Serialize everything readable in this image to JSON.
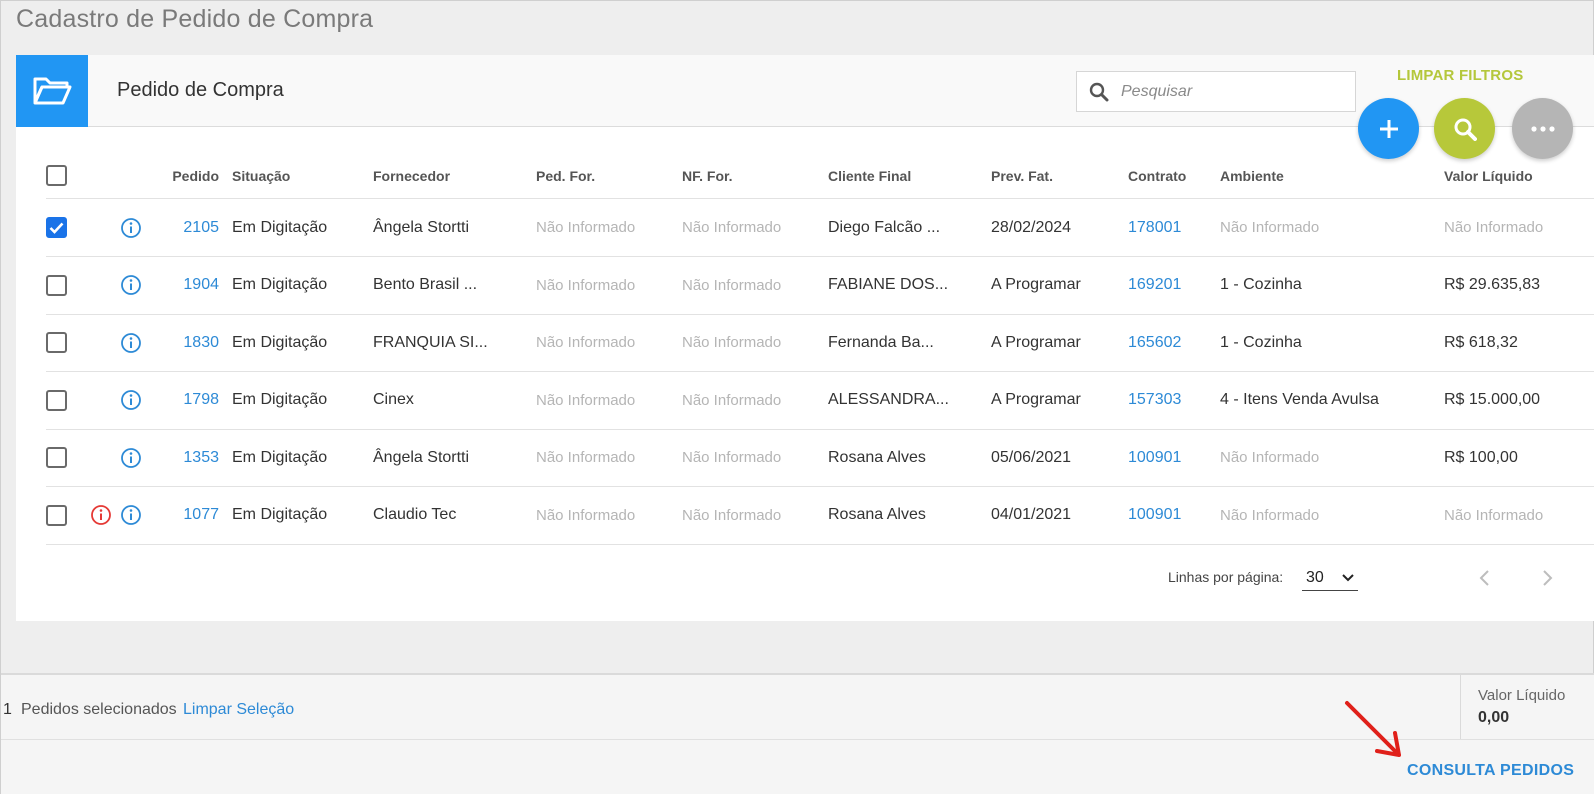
{
  "page": {
    "title": "Cadastro de Pedido de Compra"
  },
  "card": {
    "title": "Pedido de Compra",
    "search_placeholder": "Pesquisar",
    "clear_filters": "LIMPAR FILTROS",
    "icons": {
      "header": "folder-open-icon",
      "search": "search-icon",
      "add": "plus-icon",
      "filter": "search-icon",
      "more": "more-horizontal-icon"
    }
  },
  "colors": {
    "primary": "#2196f3",
    "accent": "#b7c83a",
    "link": "#2d8ad6",
    "neutral": "#b5b5b5",
    "alert": "#e53935"
  },
  "table": {
    "columns": [
      "Pedido",
      "Situação",
      "Fornecedor",
      "Ped. For.",
      "NF. For.",
      "Cliente Final",
      "Prev. Fat.",
      "Contrato",
      "Ambiente",
      "Valor Líquido"
    ],
    "rows": [
      {
        "checked": true,
        "alert": false,
        "pedido": "2105",
        "situacao": "Em Digitação",
        "fornecedor": "Ângela Stortti",
        "ped_for": "Não Informado",
        "nf_for": "Não Informado",
        "cliente": "Diego Falcão ...",
        "prev_fat": "28/02/2024",
        "contrato": "178001",
        "ambiente": "Não Informado",
        "valor": "Não Informado"
      },
      {
        "checked": false,
        "alert": false,
        "pedido": "1904",
        "situacao": "Em Digitação",
        "fornecedor": "Bento Brasil ...",
        "ped_for": "Não Informado",
        "nf_for": "Não Informado",
        "cliente": "FABIANE DOS...",
        "prev_fat": "A Programar",
        "contrato": "169201",
        "ambiente": "1 - Cozinha",
        "valor": "R$ 29.635,83"
      },
      {
        "checked": false,
        "alert": false,
        "pedido": "1830",
        "situacao": "Em Digitação",
        "fornecedor": "FRANQUIA SI...",
        "ped_for": "Não Informado",
        "nf_for": "Não Informado",
        "cliente": "Fernanda Ba...",
        "prev_fat": "A Programar",
        "contrato": "165602",
        "ambiente": "1 - Cozinha",
        "valor": "R$ 618,32"
      },
      {
        "checked": false,
        "alert": false,
        "pedido": "1798",
        "situacao": "Em Digitação",
        "fornecedor": "Cinex",
        "ped_for": "Não Informado",
        "nf_for": "Não Informado",
        "cliente": "ALESSANDRA...",
        "prev_fat": "A Programar",
        "contrato": "157303",
        "ambiente": "4 - Itens Venda Avulsa",
        "valor": "R$ 15.000,00"
      },
      {
        "checked": false,
        "alert": false,
        "pedido": "1353",
        "situacao": "Em Digitação",
        "fornecedor": "Ângela Stortti",
        "ped_for": "Não Informado",
        "nf_for": "Não Informado",
        "cliente": "Rosana Alves",
        "prev_fat": "05/06/2021",
        "contrato": "100901",
        "ambiente": "Não Informado",
        "valor": "R$ 100,00"
      },
      {
        "checked": false,
        "alert": true,
        "pedido": "1077",
        "situacao": "Em Digitação",
        "fornecedor": "Claudio Tec",
        "ped_for": "Não Informado",
        "nf_for": "Não Informado",
        "cliente": "Rosana Alves",
        "prev_fat": "04/01/2021",
        "contrato": "100901",
        "ambiente": "Não Informado",
        "valor": "Não Informado"
      }
    ]
  },
  "pager": {
    "label": "Linhas por página:",
    "value": "30"
  },
  "footer": {
    "selected_count": "1",
    "selected_label": "Pedidos selecionados",
    "clear_selection": "Limpar Seleção",
    "total_label": "Valor Líquido",
    "total_value": "0,00"
  },
  "actions": {
    "consulta": "CONSULTA PEDIDOS"
  }
}
